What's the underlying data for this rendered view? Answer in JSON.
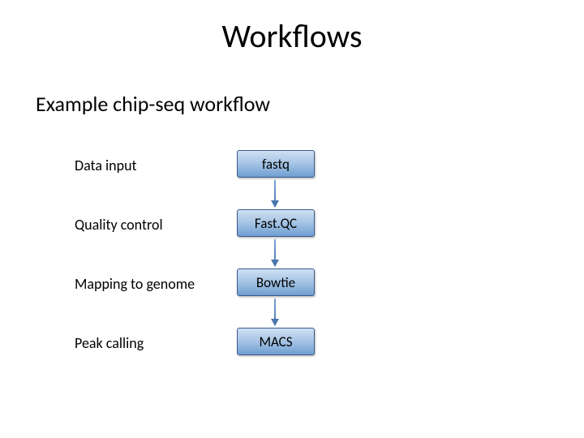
{
  "title": "Workflows",
  "subtitle": "Example chip-seq workflow",
  "steps": [
    {
      "label": "Data input",
      "box": "fastq"
    },
    {
      "label": "Quality control",
      "box": "Fast.QC"
    },
    {
      "label": "Mapping to genome",
      "box": "Bowtie"
    },
    {
      "label": "Peak calling",
      "box": "MACS"
    }
  ]
}
